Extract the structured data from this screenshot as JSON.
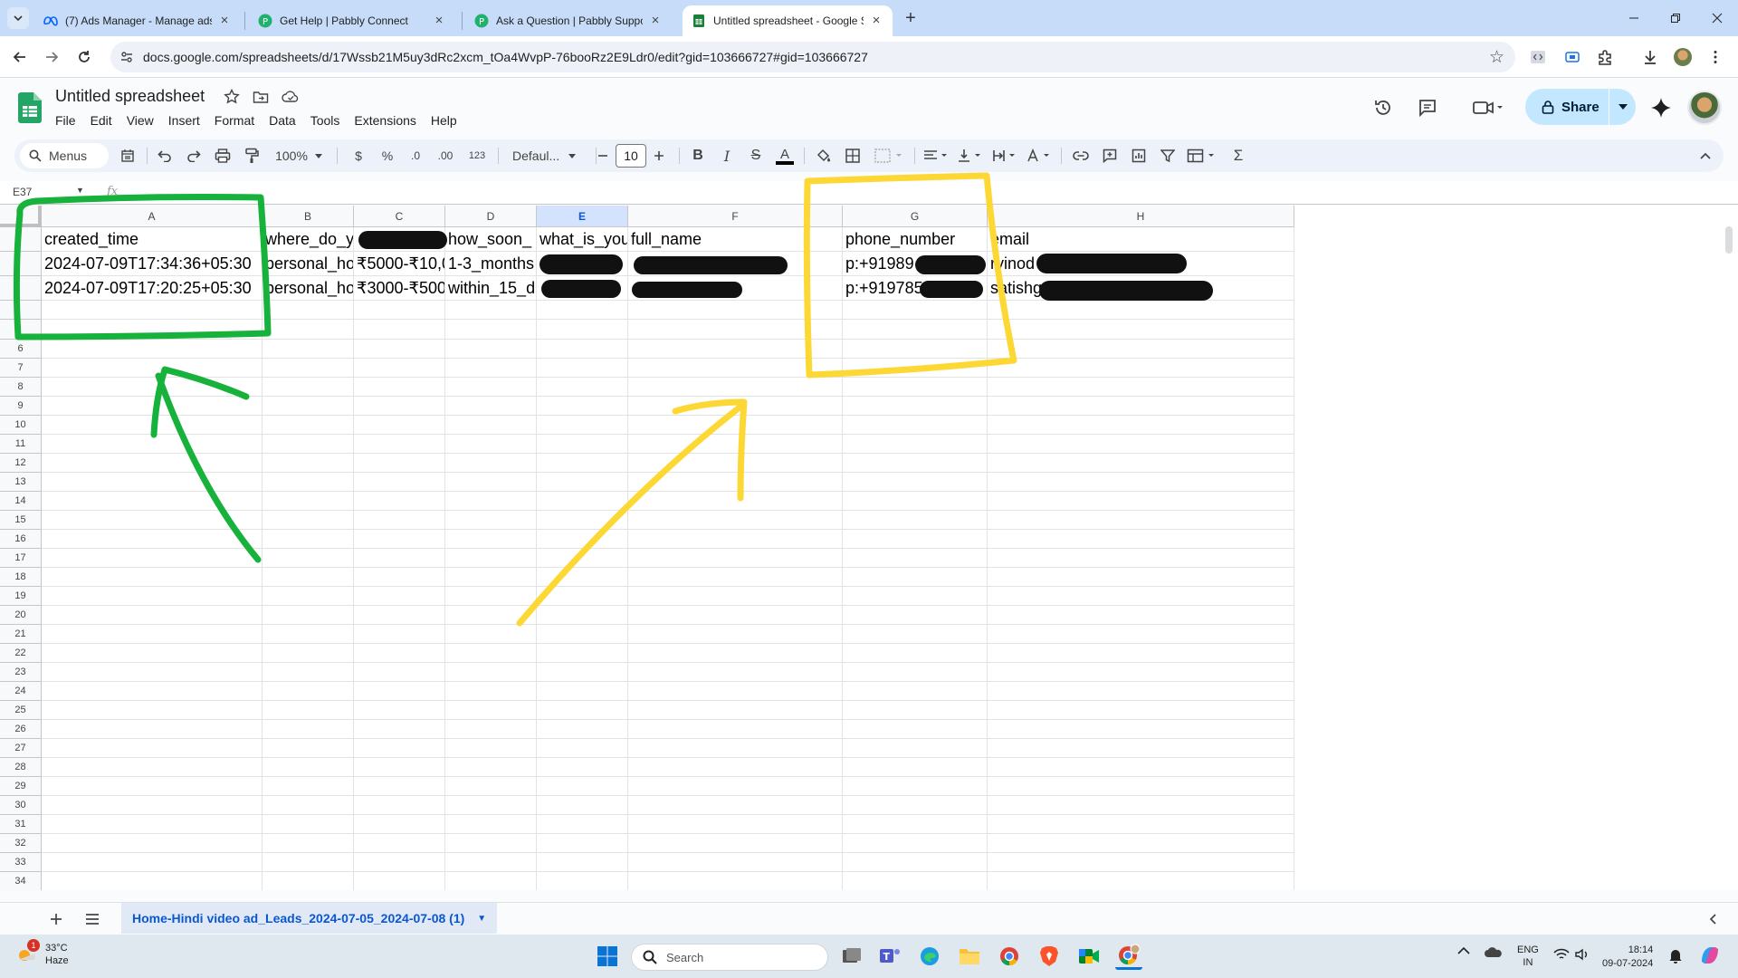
{
  "browser": {
    "tabs": [
      {
        "title": "(7) Ads Manager - Manage ads",
        "icon": "meta-icon"
      },
      {
        "title": "Get Help | Pabbly Connect",
        "icon": "pabbly-icon"
      },
      {
        "title": "Ask a Question | Pabbly Support",
        "icon": "pabbly-icon"
      },
      {
        "title": "Untitled spreadsheet - Google Sheets",
        "icon": "sheets-icon",
        "active": true
      }
    ],
    "url": "docs.google.com/spreadsheets/d/17Wssb21M5uy3dRc2xcm_tOa4WvpP-76booRz2E9Ldr0/edit?gid=103666727#gid=103666727"
  },
  "sheets": {
    "title": "Untitled spreadsheet",
    "menu": [
      "File",
      "Edit",
      "View",
      "Insert",
      "Format",
      "Data",
      "Tools",
      "Extensions",
      "Help"
    ],
    "share_label": "Share",
    "toolbar": {
      "menus_label": "Menus",
      "zoom": "100%",
      "currency": "$",
      "percent": "%",
      "dec_decrease": ".0",
      "dec_increase": ".00",
      "number_format": "123",
      "font": "Defaul...",
      "font_size": "10"
    },
    "name_box": "E37",
    "fx": "fx"
  },
  "grid": {
    "columns": [
      "A",
      "B",
      "C",
      "D",
      "E",
      "F",
      "G",
      "H"
    ],
    "selected_column": "E",
    "rows": [
      [
        "created_time",
        "where_do_you",
        "",
        "how_soon_",
        "what_is_you",
        "full_name",
        "phone_number",
        "email"
      ],
      [
        "2024-07-09T17:34:36+05:30",
        "personal_ho",
        "",
        "1-3_months",
        "",
        "",
        "p:+91989",
        "rvinod"
      ],
      [
        "2024-07-09T17:20:25+05:30",
        "personal_ho",
        "₹3000-₹500",
        "within_15_d",
        "",
        "",
        "p:+919785",
        "satishg"
      ]
    ],
    "row2_c": "₹5000-₹10,0",
    "row_numbers": [
      "6",
      "7",
      "8",
      "9",
      "10",
      "11",
      "12",
      "13",
      "14",
      "15",
      "16",
      "17",
      "18",
      "19",
      "20",
      "21",
      "22",
      "23",
      "24",
      "25",
      "26",
      "27",
      "28",
      "29",
      "30",
      "31",
      "32",
      "33",
      "34"
    ]
  },
  "sheet_tab": "Home-Hindi video ad_Leads_2024-07-05_2024-07-08 (1)",
  "taskbar": {
    "temp": "33°C",
    "weather": "Haze",
    "badge": "1",
    "search_placeholder": "Search",
    "lang1": "ENG",
    "lang2": "IN",
    "time": "18:14",
    "date": "09-07-2024"
  },
  "colors": {
    "annotation_green": "#17b23b",
    "annotation_yellow": "#fdd835",
    "sheets_green": "#188038",
    "selected_header": "#d3e3fd"
  }
}
